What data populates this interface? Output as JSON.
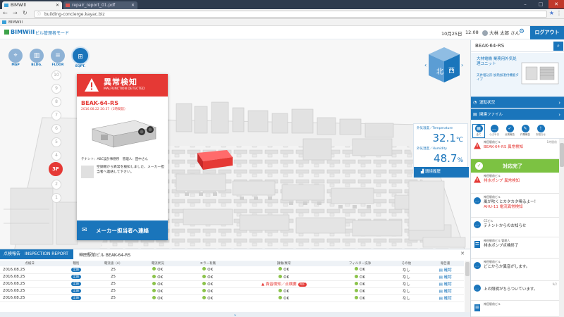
{
  "browser": {
    "tabs": [
      {
        "label": "BIMWill",
        "active": true
      },
      {
        "label": "repair_report_01.pdf",
        "active": false
      }
    ],
    "url": "building-concierge.kayac.biz",
    "bookmark": "BIMWill"
  },
  "header": {
    "logo": "BIMWill",
    "mode": "ビル管理者モード",
    "date": "10月25日",
    "time": "12:08",
    "user": "大林 太郎 さん",
    "logout": "ログアウト"
  },
  "nav": [
    {
      "label": "MAP",
      "icon": "pin-icon"
    },
    {
      "label": "BLDG.",
      "icon": "building-icon"
    },
    {
      "label": "FLOOR",
      "icon": "floor-icon"
    },
    {
      "label": "EQPT.",
      "icon": "equipment-icon",
      "selected": true
    }
  ],
  "floors": [
    "10",
    "9",
    "8",
    "7",
    "6",
    "5",
    "4",
    "3F",
    "2",
    "1"
  ],
  "current_floor": "3F",
  "compass": {
    "north": "北",
    "west": "西"
  },
  "alert": {
    "title": "異常検知",
    "subtitle": "MALFUNCTION DETECTED",
    "model": "BEAK-64-RS",
    "timestamp": "2016.08.22 20:37（1時間前）",
    "tenant": "テナント：ABC設計事務所　管理人：田中さん",
    "message": "空調機から異常を検知しました、メーカー担当者へ連絡して下さい。",
    "contact_button": "メーカー担当者へ連絡"
  },
  "sensor": {
    "temp_label": "外気温度／Temperature",
    "temp_value": "32.1",
    "temp_unit": "℃",
    "humidity_label": "外気湿度／Humidity",
    "humidity_value": "48.7",
    "humidity_unit": "%",
    "trend_button": "環境履歴"
  },
  "report": {
    "tab_label": "点検報告　INSPECTION REPORT",
    "target": "神田駅前ビル BEAK-64-RS",
    "columns": [
      "点検日",
      "種別",
      "電流値（A）",
      "電流状況",
      "エラー有無",
      "損傷/異常",
      "フィルター洗浄",
      "その他",
      "報告書"
    ],
    "rows": [
      {
        "date": "2016.08.25",
        "type": "定期",
        "amp": "25",
        "current": "OK",
        "error": "OK",
        "damage": "OK",
        "damage_ng": false,
        "filter": "OK",
        "other": "なし",
        "link": "確認"
      },
      {
        "date": "2016.08.25",
        "type": "定期",
        "amp": "25",
        "current": "OK",
        "error": "OK",
        "damage": "OK",
        "damage_ng": false,
        "filter": "OK",
        "other": "なし",
        "link": "確認"
      },
      {
        "date": "2016.08.25",
        "type": "定期",
        "amp": "25",
        "current": "OK",
        "error": "OK",
        "damage": "異音検知／点検要",
        "damage_ng": true,
        "pdf": "PDF",
        "filter": "OK",
        "other": "なし",
        "link": "確認"
      },
      {
        "date": "2016.08.25",
        "type": "定期",
        "amp": "25",
        "current": "OK",
        "error": "OK",
        "damage": "OK",
        "damage_ng": false,
        "filter": "OK",
        "other": "なし",
        "link": "確認"
      },
      {
        "date": "2016.08.25",
        "type": "定期",
        "amp": "25",
        "current": "OK",
        "error": "OK",
        "damage": "OK",
        "damage_ng": false,
        "filter": "OK",
        "other": "なし",
        "link": "確認"
      }
    ]
  },
  "right_panel": {
    "search_value": "BEAK-64-RS",
    "unit_name": "大林電機 業務用外気処理ユニット",
    "unit_sub": "天井埋込形 加熱加湿付機能タイプ",
    "status_label": "運転状況",
    "files_label": "関連ファイル",
    "tabs": [
      "全て",
      "つぶやき",
      "点検報告",
      "作業報告",
      "お知らせ"
    ],
    "feed": [
      {
        "title": "神田駅前ビル",
        "time": "1時間前",
        "line1": "BEAK-64-RS 異常検知",
        "line2": "",
        "kind": "alert"
      },
      {
        "title": "神田駅前ビル",
        "time": "",
        "line1": "排水ポンプ 異常検知",
        "line2": "",
        "kind": "alert"
      },
      {
        "title": "神田駅前ビル",
        "time": "",
        "line1": "風が吹くとカタカタ鳴るよー！",
        "line2": "AHU-11 電流異常検知",
        "kind": "chat"
      },
      {
        "title": "CCビル",
        "time": "",
        "line1": "テナントからのお知らせ",
        "line2": "",
        "kind": "chat"
      },
      {
        "title": "神田駅前ビル 管理人",
        "time": "",
        "line1": "排水ポンプ点検終了",
        "line2": "",
        "kind": "doc"
      },
      {
        "title": "神田駅前ビル",
        "time": "",
        "line1": "どこからか異音がします。",
        "line2": "",
        "kind": "chat"
      },
      {
        "title": "",
        "time": "9/2",
        "line1": "上の照明がちらついています。",
        "line2": "",
        "kind": "chat"
      },
      {
        "title": "神田駅前ビル",
        "time": "",
        "line1": "",
        "line2": "",
        "kind": "doc"
      }
    ],
    "complete_label": "対応完了"
  },
  "colors": {
    "accent": "#1a75bb",
    "alert": "#e53935",
    "ok": "#7cc242"
  }
}
